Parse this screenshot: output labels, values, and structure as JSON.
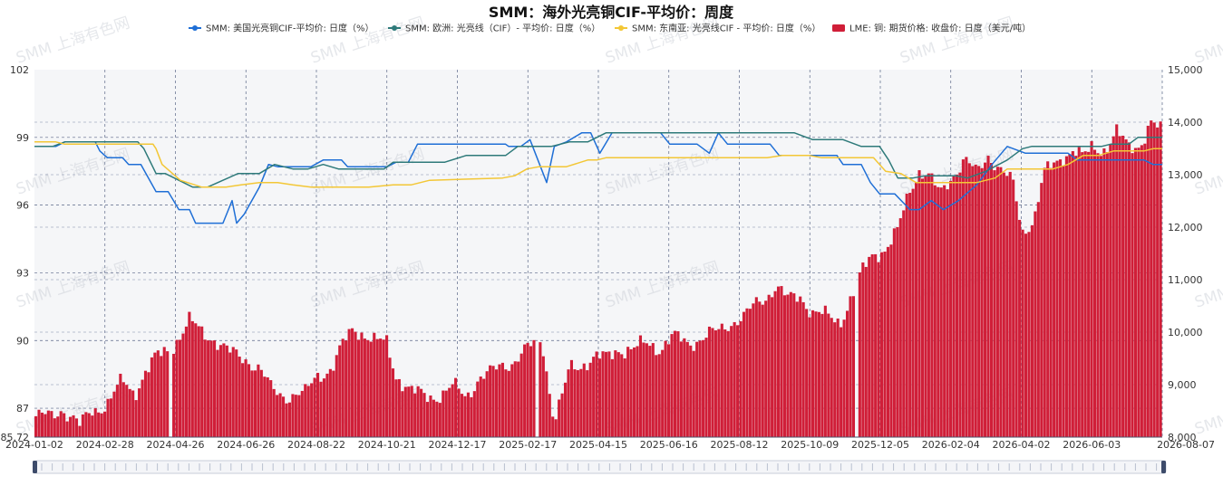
{
  "chart_data": {
    "type": "bar+line",
    "title": "SMM：海外光亮铜CIF-平均价：周度",
    "watermark": "SMM 上海有色网",
    "y_left": {
      "ticks": [
        "102",
        "99",
        "96",
        "93",
        "90",
        "87",
        "85.72"
      ],
      "range": [
        85.72,
        102
      ]
    },
    "y_right": {
      "ticks": [
        "15,000",
        "14,000",
        "13,000",
        "12,000",
        "11,000",
        "10,000",
        "9,000",
        "8,000"
      ],
      "range": [
        8000,
        15000
      ]
    },
    "x_ticks": [
      "2024-01-02",
      "2024-02-28",
      "2024-04-26",
      "2024-06-26",
      "2024-08-22",
      "2024-10-21",
      "2024-12-17",
      "2025-02-17",
      "2025-04-15",
      "2025-06-16",
      "2025-08-12",
      "2025-10-09",
      "2025-12-05",
      "2026-02-04",
      "2026-04-02",
      "2026-06-03",
      "2026-08-07"
    ],
    "series": [
      {
        "name": "SMM: 美国光亮铜CIF-平均价: 日度（%）",
        "type": "line",
        "axis": "left",
        "color": "#1f6fd6",
        "points": [
          [
            0,
            98.6
          ],
          [
            0.7,
            98.6
          ],
          [
            1,
            98.8
          ],
          [
            2,
            98.8
          ],
          [
            2.15,
            98.4
          ],
          [
            2.4,
            98.1
          ],
          [
            2.9,
            98.1
          ],
          [
            3.1,
            97.8
          ],
          [
            3.5,
            97.8
          ],
          [
            4,
            96.6
          ],
          [
            4.4,
            96.6
          ],
          [
            4.75,
            95.8
          ],
          [
            5.1,
            95.8
          ],
          [
            5.3,
            95.2
          ],
          [
            6.2,
            95.2
          ],
          [
            6.5,
            96.2
          ],
          [
            6.65,
            95.2
          ],
          [
            6.9,
            95.6
          ],
          [
            7.4,
            96.8
          ],
          [
            7.7,
            97.8
          ],
          [
            8,
            97.7
          ],
          [
            9.1,
            97.7
          ],
          [
            9.5,
            98
          ],
          [
            10.1,
            98
          ],
          [
            10.3,
            97.7
          ],
          [
            11.6,
            97.7
          ],
          [
            11.9,
            97.9
          ],
          [
            12.3,
            97.9
          ],
          [
            12.6,
            98.7
          ],
          [
            15.5,
            98.7
          ],
          [
            15.6,
            98.6
          ],
          [
            16,
            98.6
          ],
          [
            16.3,
            98.9
          ],
          [
            16.85,
            97
          ],
          [
            17.1,
            98.6
          ],
          [
            17.5,
            98.8
          ],
          [
            18,
            99.2
          ],
          [
            18.3,
            99.2
          ],
          [
            18.6,
            98.3
          ],
          [
            19,
            99.2
          ],
          [
            19.3,
            99.2
          ],
          [
            20.6,
            99.2
          ],
          [
            20.9,
            98.7
          ],
          [
            21.8,
            98.7
          ],
          [
            22.2,
            98.3
          ],
          [
            22.5,
            99.2
          ],
          [
            22.8,
            98.7
          ],
          [
            24.2,
            98.7
          ],
          [
            24.5,
            98.2
          ],
          [
            26.4,
            98.2
          ],
          [
            26.6,
            97.8
          ],
          [
            27.2,
            97.8
          ],
          [
            27.5,
            97
          ],
          [
            27.8,
            96.5
          ],
          [
            28.3,
            96.5
          ],
          [
            28.8,
            95.8
          ],
          [
            29.1,
            95.8
          ],
          [
            29.5,
            96.2
          ],
          [
            29.9,
            95.8
          ],
          [
            30.4,
            96.2
          ],
          [
            31,
            96.9
          ],
          [
            31.5,
            97.8
          ],
          [
            32,
            98.6
          ],
          [
            32.6,
            98.3
          ],
          [
            33.3,
            98.3
          ],
          [
            34,
            98.3
          ],
          [
            34.3,
            98
          ],
          [
            36.5,
            98
          ],
          [
            36.8,
            97.8
          ],
          [
            37.1,
            97.8
          ]
        ]
      },
      {
        "name": "SMM: 欧洲: 光亮线（CIF）- 平均价: 日度（%）",
        "type": "line",
        "axis": "left",
        "color": "#2e7a7a",
        "points": [
          [
            0,
            98.6
          ],
          [
            0.6,
            98.6
          ],
          [
            1,
            98.8
          ],
          [
            3.4,
            98.8
          ],
          [
            3.6,
            98.5
          ],
          [
            4,
            97.4
          ],
          [
            4.3,
            97.4
          ],
          [
            5.2,
            96.8
          ],
          [
            5.7,
            96.8
          ],
          [
            6.2,
            97.1
          ],
          [
            6.7,
            97.4
          ],
          [
            7.4,
            97.4
          ],
          [
            7.9,
            97.8
          ],
          [
            8.5,
            97.6
          ],
          [
            9,
            97.6
          ],
          [
            9.5,
            97.8
          ],
          [
            10,
            97.6
          ],
          [
            11.5,
            97.6
          ],
          [
            11.8,
            97.9
          ],
          [
            13.5,
            97.9
          ],
          [
            14.2,
            98.2
          ],
          [
            15.5,
            98.2
          ],
          [
            15.9,
            98.6
          ],
          [
            17,
            98.6
          ],
          [
            17.6,
            98.8
          ],
          [
            18.2,
            98.8
          ],
          [
            18.8,
            99.2
          ],
          [
            25,
            99.2
          ],
          [
            25.6,
            98.9
          ],
          [
            26.6,
            98.9
          ],
          [
            27.2,
            98.6
          ],
          [
            27.8,
            98.6
          ],
          [
            28.1,
            98
          ],
          [
            28.4,
            97.2
          ],
          [
            28.9,
            97.2
          ],
          [
            29.3,
            97.3
          ],
          [
            30.3,
            97.3
          ],
          [
            30.7,
            97.2
          ],
          [
            31.3,
            97.5
          ],
          [
            32,
            98
          ],
          [
            32.5,
            98.5
          ],
          [
            32.8,
            98.6
          ],
          [
            34,
            98.6
          ],
          [
            35.1,
            98.6
          ],
          [
            35.4,
            98.7
          ],
          [
            36,
            98.7
          ],
          [
            36.3,
            99
          ],
          [
            36.8,
            99
          ],
          [
            37.1,
            99
          ]
        ]
      },
      {
        "name": "SMM: 东南亚: 光亮线CIF - 平均价: 日度（%）",
        "type": "line",
        "axis": "left",
        "color": "#f3c736",
        "points": [
          [
            0,
            98.8
          ],
          [
            0.7,
            98.8
          ],
          [
            1,
            98.7
          ],
          [
            3.9,
            98.7
          ],
          [
            4,
            98.5
          ],
          [
            4.2,
            97.8
          ],
          [
            4.8,
            97.1
          ],
          [
            5.5,
            96.8
          ],
          [
            6.3,
            96.8
          ],
          [
            6.8,
            96.9
          ],
          [
            7.4,
            97
          ],
          [
            8,
            97
          ],
          [
            8.5,
            96.9
          ],
          [
            9.1,
            96.8
          ],
          [
            11,
            96.8
          ],
          [
            11.8,
            96.9
          ],
          [
            12.4,
            96.9
          ],
          [
            13,
            97.1
          ],
          [
            15.4,
            97.2
          ],
          [
            15.8,
            97.3
          ],
          [
            16.2,
            97.6
          ],
          [
            16.6,
            97.7
          ],
          [
            17.5,
            97.7
          ],
          [
            18.2,
            98
          ],
          [
            18.5,
            98
          ],
          [
            18.8,
            98.1
          ],
          [
            24.1,
            98.1
          ],
          [
            24.6,
            98.2
          ],
          [
            25.5,
            98.2
          ],
          [
            25.9,
            98.1
          ],
          [
            27.6,
            98.1
          ],
          [
            28,
            97.5
          ],
          [
            28.5,
            97.4
          ],
          [
            29,
            97
          ],
          [
            30.5,
            97
          ],
          [
            31,
            97
          ],
          [
            31.6,
            97.2
          ],
          [
            32,
            97.6
          ],
          [
            32.6,
            97.6
          ],
          [
            33.5,
            97.6
          ],
          [
            34,
            97.8
          ],
          [
            34.5,
            98.2
          ],
          [
            35,
            98.2
          ],
          [
            35.5,
            98.4
          ],
          [
            36.5,
            98.4
          ],
          [
            36.8,
            98.5
          ],
          [
            37.1,
            98.5
          ]
        ]
      },
      {
        "name": "LME: 铜: 期货价格: 收盘价: 日度（美元/吨）",
        "type": "bar",
        "axis": "right",
        "color": "#d01e38",
        "points": [
          [
            0,
            8400
          ],
          [
            0.6,
            8380
          ],
          [
            0.9,
            8560
          ],
          [
            1.2,
            8420
          ],
          [
            1.5,
            8200
          ],
          [
            1.9,
            8500
          ],
          [
            2.4,
            8650
          ],
          [
            2.9,
            9050
          ],
          [
            3.3,
            8850
          ],
          [
            3.6,
            9200
          ],
          [
            4,
            9500
          ],
          [
            4.5,
            9700
          ],
          [
            5.1,
            10200
          ],
          [
            5.5,
            10000
          ],
          [
            5.9,
            9900
          ],
          [
            6.4,
            9600
          ],
          [
            7,
            9500
          ],
          [
            7.4,
            9300
          ],
          [
            7.8,
            8900
          ],
          [
            8.3,
            8800
          ],
          [
            8.9,
            8800
          ],
          [
            9.3,
            9200
          ],
          [
            9.8,
            9300
          ],
          [
            10.2,
            9800
          ],
          [
            10.5,
            10100
          ],
          [
            10.8,
            10000
          ],
          [
            11.2,
            9800
          ],
          [
            11.6,
            9800
          ],
          [
            11.9,
            9200
          ],
          [
            12.4,
            8850
          ],
          [
            12.8,
            8800
          ],
          [
            13.4,
            8800
          ],
          [
            13.8,
            8950
          ],
          [
            14.2,
            8800
          ],
          [
            14.6,
            9100
          ],
          [
            15,
            9200
          ],
          [
            15.4,
            9400
          ],
          [
            15.8,
            9450
          ],
          [
            16.3,
            9700
          ],
          [
            16.7,
            9900
          ],
          [
            17.1,
            8300
          ],
          [
            17.4,
            8800
          ],
          [
            17.6,
            9300
          ],
          [
            18,
            9400
          ],
          [
            18.4,
            9500
          ],
          [
            18.8,
            9500
          ],
          [
            19.2,
            9700
          ],
          [
            19.7,
            9650
          ],
          [
            20.2,
            9800
          ],
          [
            20.6,
            9700
          ],
          [
            21,
            9900
          ],
          [
            21.5,
            9800
          ],
          [
            22,
            9900
          ],
          [
            22.5,
            10000
          ],
          [
            22.9,
            10200
          ],
          [
            23.4,
            10300
          ],
          [
            23.7,
            10500
          ],
          [
            24.1,
            10700
          ],
          [
            24.4,
            10900
          ],
          [
            24.8,
            10600
          ],
          [
            25.2,
            10700
          ],
          [
            25.6,
            10400
          ],
          [
            26,
            10300
          ],
          [
            26.5,
            10200
          ],
          [
            26.9,
            10700
          ],
          [
            27.3,
            11200
          ],
          [
            27.6,
            11500
          ],
          [
            28,
            11600
          ],
          [
            28.4,
            11900
          ],
          [
            28.8,
            12700
          ],
          [
            29.1,
            13100
          ],
          [
            29.4,
            13000
          ],
          [
            29.8,
            12600
          ],
          [
            30.2,
            13000
          ],
          [
            30.6,
            13300
          ],
          [
            31,
            13000
          ],
          [
            31.4,
            13400
          ],
          [
            31.8,
            13100
          ],
          [
            32.2,
            12800
          ],
          [
            32.5,
            11900
          ],
          [
            32.9,
            12200
          ],
          [
            33.2,
            13000
          ],
          [
            33.6,
            13200
          ],
          [
            33.9,
            13400
          ],
          [
            34.2,
            13500
          ],
          [
            34.5,
            13300
          ],
          [
            34.8,
            13500
          ],
          [
            35.2,
            13500
          ],
          [
            35.6,
            13800
          ],
          [
            36,
            13500
          ],
          [
            36.4,
            13600
          ],
          [
            36.7,
            14000
          ],
          [
            37.1,
            13800
          ]
        ]
      }
    ]
  }
}
